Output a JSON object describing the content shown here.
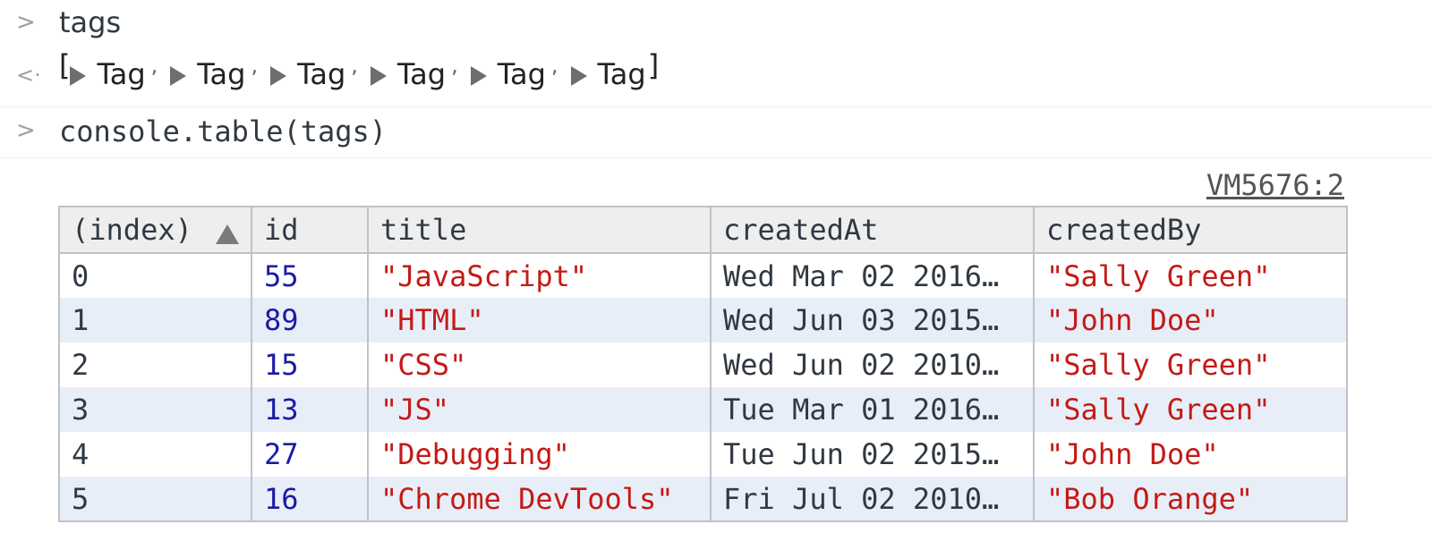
{
  "console": {
    "line1": {
      "prompt": ">",
      "input": "tags"
    },
    "line2": {
      "prompt": "<·",
      "open": "[",
      "items": [
        "Tag",
        "Tag",
        "Tag",
        "Tag",
        "Tag",
        "Tag"
      ],
      "close": "]"
    },
    "line3": {
      "prompt": ">",
      "input": "console.table(tags)"
    },
    "source_link": "VM5676:2"
  },
  "table": {
    "headers": [
      "(index)",
      "id",
      "title",
      "createdAt",
      "createdBy"
    ],
    "rows": [
      [
        "0",
        "55",
        "\"JavaScript\"",
        "Wed Mar 02 2016…",
        "\"Sally Green\""
      ],
      [
        "1",
        "89",
        "\"HTML\"",
        "Wed Jun 03 2015…",
        "\"John Doe\""
      ],
      [
        "2",
        "15",
        "\"CSS\"",
        "Wed Jun 02 2010…",
        "\"Sally Green\""
      ],
      [
        "3",
        "13",
        "\"JS\"",
        "Tue Mar 01 2016…",
        "\"Sally Green\""
      ],
      [
        "4",
        "27",
        "\"Debugging\"",
        "Tue Jun 02 2015…",
        "\"John Doe\""
      ],
      [
        "5",
        "16",
        "\"Chrome DevTools\"",
        "Fri Jul 02 2010…",
        "\"Bob Orange\""
      ]
    ]
  },
  "icons": {
    "prompt": "chevron-right-icon",
    "result": "return-arrow-icon",
    "expand": "triangle-right-icon",
    "sort": "sort-ascending-icon"
  },
  "colors": {
    "number": "#1a1aa6",
    "string": "#c41a16",
    "header_bg": "#eeeeee",
    "stripe_bg": "#e8eef8"
  }
}
